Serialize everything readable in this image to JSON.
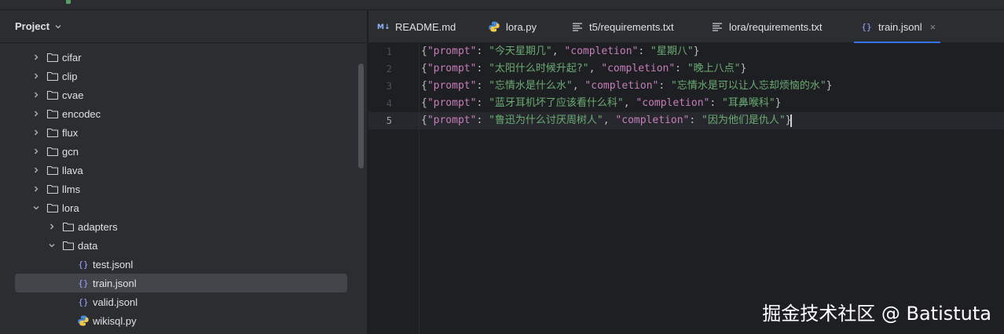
{
  "project": {
    "title": "Project"
  },
  "tree": [
    {
      "label": "cifar",
      "type": "folder",
      "depth": 0,
      "expanded": false
    },
    {
      "label": "clip",
      "type": "folder",
      "depth": 0,
      "expanded": false
    },
    {
      "label": "cvae",
      "type": "folder",
      "depth": 0,
      "expanded": false
    },
    {
      "label": "encodec",
      "type": "folder",
      "depth": 0,
      "expanded": false
    },
    {
      "label": "flux",
      "type": "folder",
      "depth": 0,
      "expanded": false
    },
    {
      "label": "gcn",
      "type": "folder",
      "depth": 0,
      "expanded": false
    },
    {
      "label": "llava",
      "type": "folder",
      "depth": 0,
      "expanded": false
    },
    {
      "label": "llms",
      "type": "folder",
      "depth": 0,
      "expanded": false
    },
    {
      "label": "lora",
      "type": "folder",
      "depth": 0,
      "expanded": true
    },
    {
      "label": "adapters",
      "type": "folder",
      "depth": 1,
      "expanded": false
    },
    {
      "label": "data",
      "type": "folder",
      "depth": 1,
      "expanded": true
    },
    {
      "label": "test.jsonl",
      "type": "json",
      "depth": 2
    },
    {
      "label": "train.jsonl",
      "type": "json",
      "depth": 2,
      "selected": true
    },
    {
      "label": "valid.jsonl",
      "type": "json",
      "depth": 2
    },
    {
      "label": "wikisql.py",
      "type": "python",
      "depth": 2
    }
  ],
  "tabs": [
    {
      "label": "README.md",
      "icon": "markdown-icon"
    },
    {
      "label": "lora.py",
      "icon": "python-icon"
    },
    {
      "label": "t5/requirements.txt",
      "icon": "text-file-icon"
    },
    {
      "label": "lora/requirements.txt",
      "icon": "text-file-icon"
    },
    {
      "label": "train.jsonl",
      "icon": "json-icon",
      "active": true
    }
  ],
  "tab_close": "×",
  "editor": {
    "current_line": 5,
    "lines": [
      {
        "num": "1",
        "k1": "\"prompt\"",
        "v1": "\"今天星期几\"",
        "k2": "\"completion\"",
        "v2": "\"星期八\""
      },
      {
        "num": "2",
        "k1": "\"prompt\"",
        "v1": "\"太阳什么时候升起?\"",
        "k2": "\"completion\"",
        "v2": "\"晚上八点\""
      },
      {
        "num": "3",
        "k1": "\"prompt\"",
        "v1": "\"忘情水是什么水\"",
        "k2": "\"completion\"",
        "v2": "\"忘情水是可以让人忘却烦恼的水\""
      },
      {
        "num": "4",
        "k1": "\"prompt\"",
        "v1": "\"蓝牙耳机坏了应该看什么科\"",
        "k2": "\"completion\"",
        "v2": "\"耳鼻喉科\""
      },
      {
        "num": "5",
        "k1": "\"prompt\"",
        "v1": "\"鲁迅为什么讨厌周树人\"",
        "k2": "\"completion\"",
        "v2": "\"因为他们是仇人\""
      }
    ]
  },
  "watermark": "掘金技术社区 @ Batistuta",
  "colors": {
    "background": "#1e1f22",
    "panel": "#2b2d30",
    "selection": "#43454a",
    "key": "#c77dbb",
    "string": "#6aab73",
    "accent": "#3574f0"
  }
}
